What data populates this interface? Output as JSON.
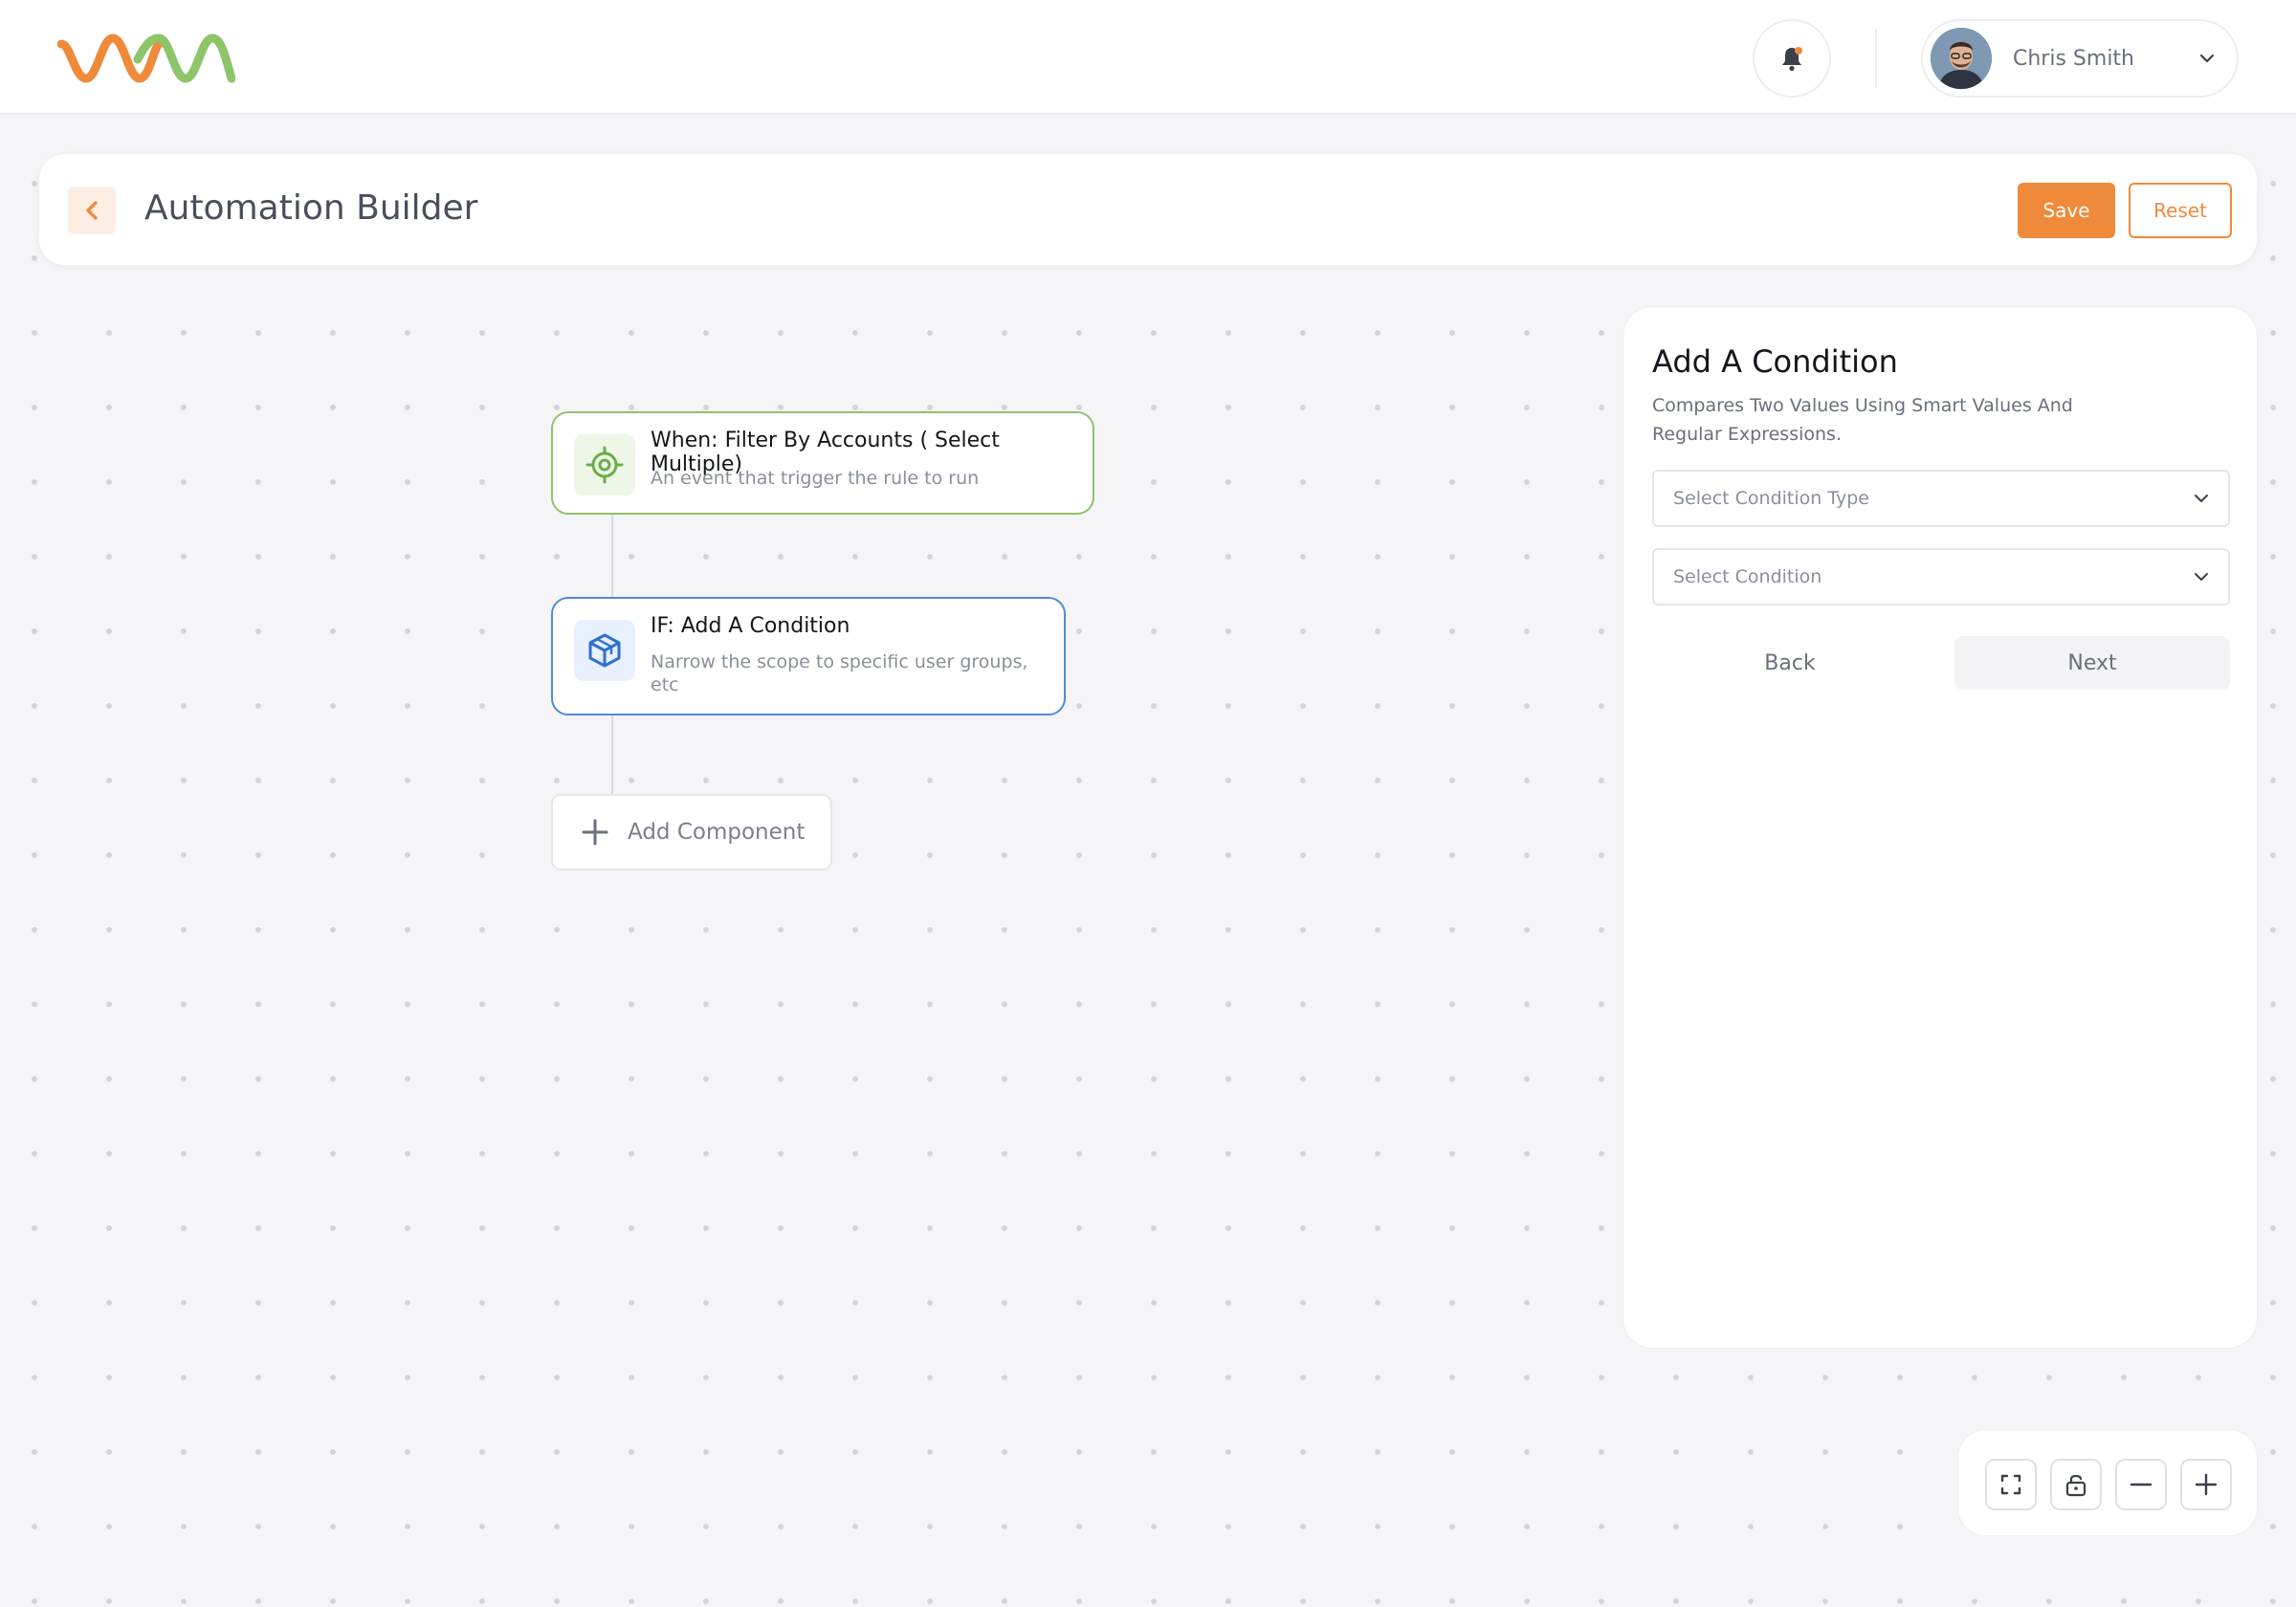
{
  "app": {
    "brand_colors": {
      "accent": "#ef8a3b",
      "green": "#8ec46a",
      "blue": "#4e8bd9"
    }
  },
  "topbar": {
    "logo_icon": "wave-logo",
    "notification_icon": "bell-icon",
    "user": {
      "name": "Chris Smith",
      "avatar_icon": "user-avatar",
      "menu_icon": "chevron-down-icon"
    }
  },
  "header": {
    "title": "Automation Builder",
    "back_icon": "chevron-left-icon",
    "save_label": "Save",
    "reset_label": "Reset"
  },
  "flow": {
    "nodes": [
      {
        "icon": "target-icon",
        "title": "When: Filter By Accounts ( Select Multiple)",
        "subtitle": "An event that trigger the rule to run"
      },
      {
        "icon": "cube-icon",
        "title": "IF: Add A Condition",
        "subtitle": "Narrow the scope to specific user groups, etc"
      }
    ],
    "add_component_label": "Add Component"
  },
  "panel": {
    "title": "Add A Condition",
    "description": "Compares Two Values Using Smart Values And Regular Expressions.",
    "condition_type_placeholder": "Select Condition Type",
    "condition_placeholder": "Select Condition",
    "back_label": "Back",
    "next_label": "Next"
  },
  "canvas_controls": [
    "fullscreen-icon",
    "lock-icon",
    "zoom-out-icon",
    "zoom-in-icon"
  ]
}
